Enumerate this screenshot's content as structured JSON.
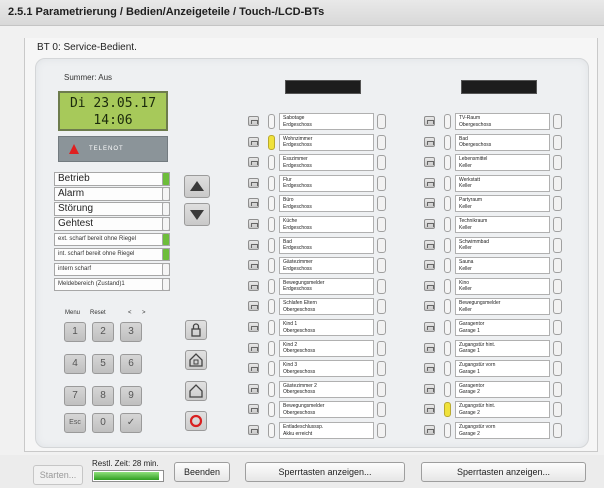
{
  "title": "2.5.1 Parametrierung / Bedien/Anzeigeteile / Touch-/LCD-BTs",
  "subtitle": "BT 0: Service-Bedient.",
  "summer": "Summer:  Aus",
  "lcd": {
    "line1": "Di 23.05.17",
    "line2": "14:06"
  },
  "logo": "TELENOT",
  "status_rows": [
    {
      "label": "Betrieb",
      "led": "green"
    },
    {
      "label": "Alarm",
      "led": "off"
    },
    {
      "label": "Störung",
      "led": "off"
    },
    {
      "label": "Gehtest",
      "led": "off"
    },
    {
      "label": "ext. scharf bereit ohne Riegel",
      "led": "green"
    },
    {
      "label": "int. scharf bereit ohne Riegel",
      "led": "green"
    },
    {
      "label": "intern scharf",
      "led": "off"
    },
    {
      "label": "Meldebereich (Zustand)1",
      "led": "off"
    }
  ],
  "keypad": {
    "labels": [
      "Menu",
      "Reset",
      "<",
      ">"
    ],
    "keys": [
      "1",
      "2",
      "3",
      "4",
      "5",
      "6",
      "7",
      "8",
      "9",
      "Esc",
      "0",
      "✓"
    ]
  },
  "zones_left": [
    {
      "name": "Sabotage",
      "floor": "Erdgeschoss",
      "led": "off"
    },
    {
      "name": "Wohnzimmer",
      "floor": "Erdgeschoss",
      "led": "yellow"
    },
    {
      "name": "Esszimmer",
      "floor": "Erdgeschoss",
      "led": "off"
    },
    {
      "name": "Flur",
      "floor": "Erdgeschoss",
      "led": "off"
    },
    {
      "name": "Büro",
      "floor": "Erdgeschoss",
      "led": "off"
    },
    {
      "name": "Küche",
      "floor": "Erdgeschoss",
      "led": "off"
    },
    {
      "name": "Bad",
      "floor": "Erdgeschoss",
      "led": "off"
    },
    {
      "name": "Gästezimmer",
      "floor": "Erdgeschoss",
      "led": "off"
    },
    {
      "name": "Bewegungsmelder",
      "floor": "Erdgeschoss",
      "led": "off"
    },
    {
      "name": "Schlafen Eltern",
      "floor": "Obergeschoss",
      "led": "off"
    },
    {
      "name": "Kind 1",
      "floor": "Obergeschoss",
      "led": "off"
    },
    {
      "name": "Kind 2",
      "floor": "Obergeschoss",
      "led": "off"
    },
    {
      "name": "Kind 3",
      "floor": "Obergeschoss",
      "led": "off"
    },
    {
      "name": "Gästezimmer 2",
      "floor": "Obergeschoss",
      "led": "off"
    },
    {
      "name": "Bewegungsmelder",
      "floor": "Obergeschoss",
      "led": "off"
    },
    {
      "name": "Entladeschlusssp.",
      "floor": "Akku erreicht",
      "led": "off"
    }
  ],
  "zones_right": [
    {
      "name": "TV-Raum",
      "floor": "Obergeschoss",
      "led": "off"
    },
    {
      "name": "Bad",
      "floor": "Obergeschoss",
      "led": "off"
    },
    {
      "name": "Lebensmittel",
      "floor": "Keller",
      "led": "off"
    },
    {
      "name": "Werkstatt",
      "floor": "Keller",
      "led": "off"
    },
    {
      "name": "Partyraum",
      "floor": "Keller",
      "led": "off"
    },
    {
      "name": "Technikraum",
      "floor": "Keller",
      "led": "off"
    },
    {
      "name": "Schwimmbad",
      "floor": "Keller",
      "led": "off"
    },
    {
      "name": "Sauna",
      "floor": "Keller",
      "led": "off"
    },
    {
      "name": "Kino",
      "floor": "Keller",
      "led": "off"
    },
    {
      "name": "Bewegungsmelder",
      "floor": "Keller",
      "led": "off"
    },
    {
      "name": "Garagentor",
      "floor": "Garage 1",
      "led": "off"
    },
    {
      "name": "Zugangstür hint.",
      "floor": "Garage 1",
      "led": "off"
    },
    {
      "name": "Zugangstür vorn",
      "floor": "Garage 1",
      "led": "off"
    },
    {
      "name": "Garagentor",
      "floor": "Garage 2",
      "led": "off"
    },
    {
      "name": "Zugangstür hint.",
      "floor": "Garage 2",
      "led": "yellow"
    },
    {
      "name": "Zugangstür vorn",
      "floor": "Garage 2",
      "led": "off"
    }
  ],
  "bottom": {
    "start_label": "Starten...",
    "restl_label": "Restl. Zeit: 28 min.",
    "progress": 0.95,
    "beenden_label": "Beenden",
    "sperr1_label": "Sperrtasten anzeigen...",
    "sperr2_label": "Sperrtasten anzeigen..."
  },
  "colors": {
    "lcd": "#a7c95a",
    "led_green": "#6dbd3a",
    "led_yellow": "#f0e23b",
    "progress": "#2f9e20"
  }
}
